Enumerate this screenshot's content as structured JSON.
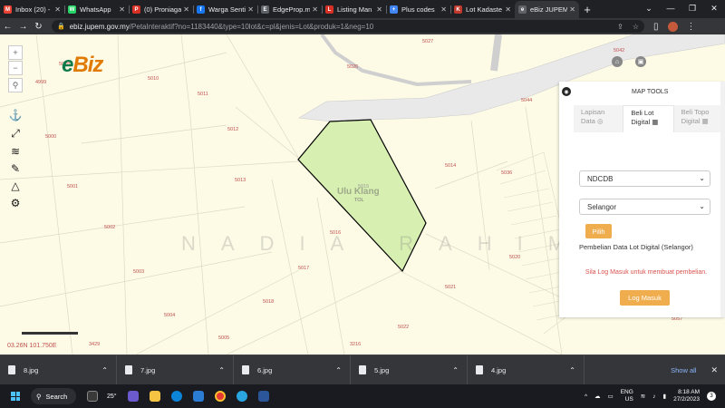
{
  "tabs": [
    {
      "title": "Inbox (20) -",
      "icon": "gmail-icon",
      "color": "#ea4335",
      "glyph": "M"
    },
    {
      "title": "WhatsApp",
      "icon": "whatsapp-icon",
      "color": "#25d366",
      "glyph": "W"
    },
    {
      "title": "(0) Proniaga",
      "icon": "proniaga-icon",
      "color": "#d93025",
      "glyph": "P"
    },
    {
      "title": "Warga Senti",
      "icon": "facebook-icon",
      "color": "#1877f2",
      "glyph": "f"
    },
    {
      "title": "EdgeProp.m",
      "icon": "edgeprop-icon",
      "color": "#5f6368",
      "glyph": "E"
    },
    {
      "title": "Listing Man",
      "icon": "listing-icon",
      "color": "#d93025",
      "glyph": "L"
    },
    {
      "title": "Plus codes",
      "icon": "pluscodes-icon",
      "color": "#4285f4",
      "glyph": "+"
    },
    {
      "title": "Lot Kadaste",
      "icon": "lot-icon",
      "color": "#c0392b",
      "glyph": "K"
    },
    {
      "title": "eBiz JUPEM",
      "icon": "ebiz-icon",
      "color": "#5f6368",
      "glyph": "e",
      "active": true
    }
  ],
  "url": {
    "host": "ebiz.jupem.gov.my",
    "path": "/PetaInteraktif?no=1183440&type=10lot&c=pl&jenis=Lot&produk=1&neg=10"
  },
  "logo": {
    "e": "e",
    "biz": "Biz"
  },
  "map": {
    "watermark": "NADIA RAHIM",
    "area_label": "Ulu Klang",
    "area_code": "TOL",
    "selected_lot": "5015",
    "coordinates": "03.26N 101.750E",
    "lots": [
      "5027",
      "5042",
      "5026",
      "5028",
      "4999",
      "5010",
      "5011",
      "5044",
      "5012",
      "5000",
      "5013",
      "5014",
      "5001",
      "5036",
      "5002",
      "5016",
      "5003",
      "5017",
      "5018",
      "5004",
      "5005",
      "5020",
      "5021",
      "5022",
      "5057",
      "3429",
      "3216"
    ]
  },
  "panel": {
    "title": "MAP TOOLS",
    "tab_lapisan": "Lapisan Data",
    "tab_beli_lot": "Beli Lot Digital",
    "tab_beli_topo": "Beli Topo Digital",
    "select_source": "NDCDB",
    "select_state": "Selangor",
    "pilih_label": "Pilih",
    "pembelian_text": "Pembelian Data Lot Digital (Selangor)",
    "login_prompt": "Sila Log Masuk untuk membuat pembelian.",
    "login_button": "Log Masuk"
  },
  "downloads": [
    "8.jpg",
    "7.jpg",
    "6.jpg",
    "5.jpg",
    "4.jpg"
  ],
  "show_all": "Show all",
  "taskbar": {
    "search": "Search",
    "temperature": "25°",
    "language": "ENG",
    "region": "US",
    "time": "8:18 AM",
    "date": "27/2/2023",
    "notifications": "3"
  }
}
